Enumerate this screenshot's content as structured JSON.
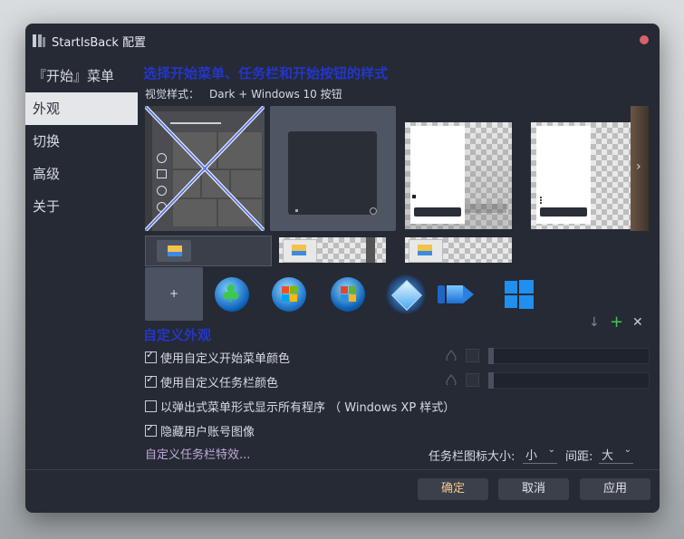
{
  "window": {
    "title": "StartIsBack 配置"
  },
  "sidebar": {
    "items": [
      {
        "label": "『开始』菜单"
      },
      {
        "label": "外观"
      },
      {
        "label": "切换"
      },
      {
        "label": "高级"
      },
      {
        "label": "关于"
      }
    ]
  },
  "appearance": {
    "heading": "选择开始菜单、任务栏和开始按钮的样式",
    "visual_style_label": "视觉样式：",
    "visual_style_value": "Dark + Windows 10 按钮"
  },
  "customize": {
    "heading": "自定义外观",
    "options": [
      {
        "label": "使用自定义开始菜单颜色",
        "checked": true
      },
      {
        "label": "使用自定义任务栏颜色",
        "checked": true
      },
      {
        "label": "以弹出式菜单形式显示所有程序 （ Windows XP 样式）",
        "checked": false
      },
      {
        "label": "隐藏用户账号图像",
        "checked": true
      }
    ],
    "taskbar_effects_link": "自定义任务栏特效...",
    "icon_size_label": "任务栏图标大小:",
    "icon_size_value": "小",
    "spacing_label": "间距:",
    "spacing_value": "大",
    "add_symbol": "+",
    "download_symbol": "↓",
    "remove_symbol": "✕"
  },
  "start_buttons": {
    "add_label": "+"
  },
  "footer": {
    "ok_label": "确定",
    "cancel_label": "取消",
    "apply_label": "应用"
  },
  "colors": {
    "accent_heading": "#2436c8",
    "close_dot": "#d9616b",
    "ok_text": "#f0c98c",
    "link": "#c2a8d8"
  }
}
